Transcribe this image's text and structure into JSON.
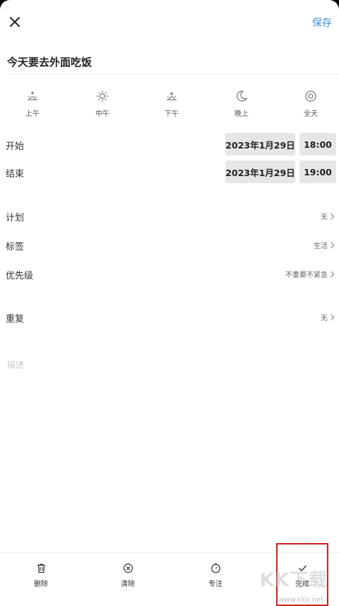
{
  "header": {
    "close_icon": "close-icon",
    "save_label": "保存",
    "accent_color": "#3d8fe0"
  },
  "task": {
    "title": "今天要去外面吃饭"
  },
  "time_slots": [
    {
      "label": "上午",
      "icon": "sunrise-icon"
    },
    {
      "label": "中午",
      "icon": "sun-icon"
    },
    {
      "label": "下午",
      "icon": "sunset-icon"
    },
    {
      "label": "晚上",
      "icon": "moon-icon"
    },
    {
      "label": "全天",
      "icon": "allday-icon"
    }
  ],
  "schedule": {
    "start": {
      "label": "开始",
      "date": "2023年1月29日",
      "time": "18:00"
    },
    "end": {
      "label": "结束",
      "date": "2023年1月29日",
      "time": "19:00"
    }
  },
  "settings": {
    "plan": {
      "label": "计划",
      "value": "无"
    },
    "tag": {
      "label": "标签",
      "value": "生活"
    },
    "priority": {
      "label": "优先级",
      "value": "不重要不紧急"
    },
    "repeat": {
      "label": "重复",
      "value": "无"
    }
  },
  "description": {
    "placeholder": "描述"
  },
  "bottom_actions": [
    {
      "label": "删除",
      "icon": "trash-icon"
    },
    {
      "label": "清除",
      "icon": "clear-icon"
    },
    {
      "label": "专注",
      "icon": "timer-icon"
    },
    {
      "label": "完成",
      "icon": "check-icon"
    }
  ],
  "highlight_color": "#d01f1f",
  "watermark": {
    "logo_text": "KK下载",
    "url": "www.kkx.net"
  }
}
